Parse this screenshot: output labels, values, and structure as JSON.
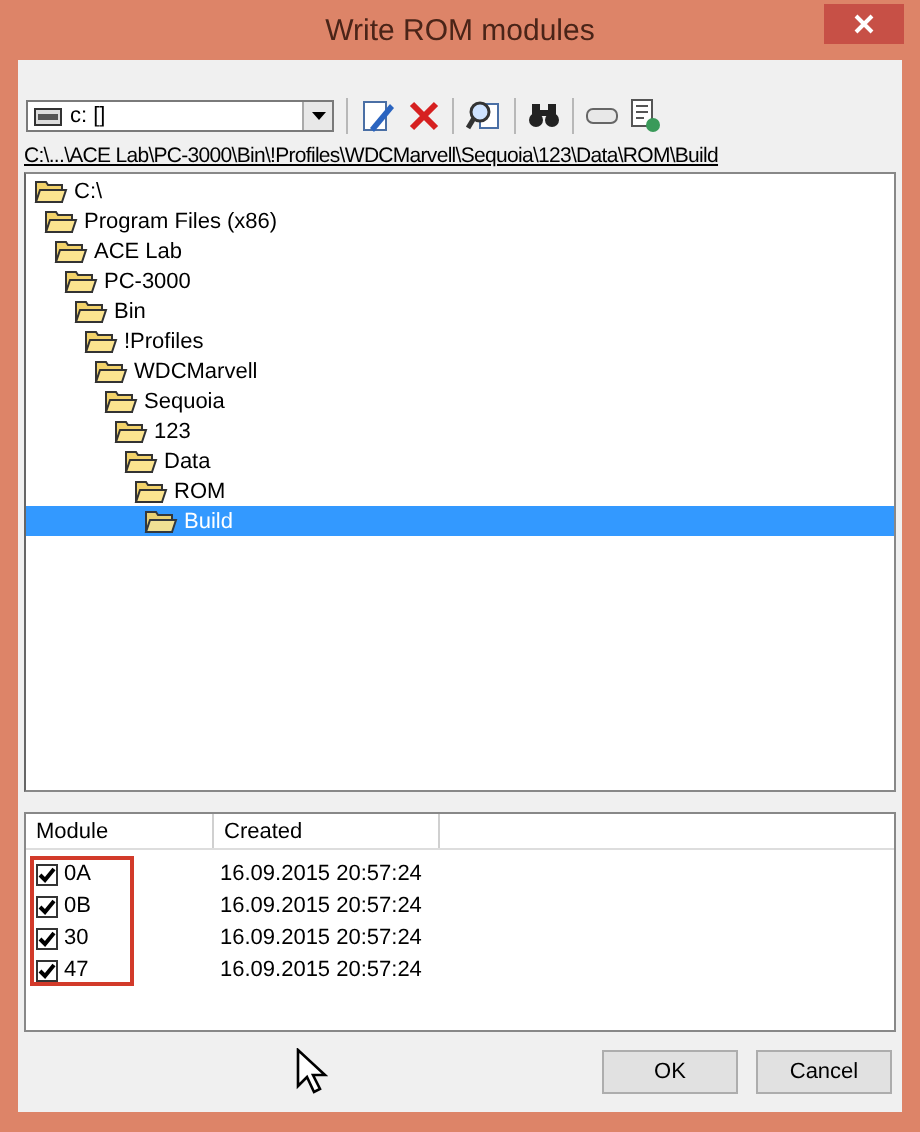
{
  "window": {
    "title": "Write ROM modules"
  },
  "drive_combo": {
    "value": "c: []"
  },
  "path": "C:\\...\\ACE Lab\\PC-3000\\Bin\\!Profiles\\WDCMarvell\\Sequoia\\123\\Data\\ROM\\Build",
  "tree": [
    {
      "label": "C:\\",
      "selected": false,
      "children": [
        {
          "label": "Program Files (x86)",
          "selected": false,
          "children": [
            {
              "label": "ACE Lab",
              "selected": false,
              "children": [
                {
                  "label": "PC-3000",
                  "selected": false,
                  "children": [
                    {
                      "label": "Bin",
                      "selected": false,
                      "children": [
                        {
                          "label": "!Profiles",
                          "selected": false,
                          "children": [
                            {
                              "label": "WDCMarvell",
                              "selected": false,
                              "children": [
                                {
                                  "label": "Sequoia",
                                  "selected": false,
                                  "children": [
                                    {
                                      "label": "123",
                                      "selected": false,
                                      "children": [
                                        {
                                          "label": "Data",
                                          "selected": false,
                                          "children": [
                                            {
                                              "label": "ROM",
                                              "selected": false,
                                              "children": [
                                                {
                                                  "label": "Build",
                                                  "selected": true
                                                }
                                              ]
                                            }
                                          ]
                                        }
                                      ]
                                    }
                                  ]
                                }
                              ]
                            }
                          ]
                        }
                      ]
                    }
                  ]
                }
              ]
            }
          ]
        }
      ]
    }
  ],
  "table": {
    "columns": [
      "Module",
      "Created"
    ],
    "rows": [
      {
        "module": "0A",
        "created": "16.09.2015 20:57:24",
        "checked": true
      },
      {
        "module": "0B",
        "created": "16.09.2015 20:57:24",
        "checked": true
      },
      {
        "module": "30",
        "created": "16.09.2015 20:57:24",
        "checked": true
      },
      {
        "module": "47",
        "created": "16.09.2015 20:57:24",
        "checked": true
      }
    ]
  },
  "buttons": [
    "OK",
    "Cancel"
  ]
}
